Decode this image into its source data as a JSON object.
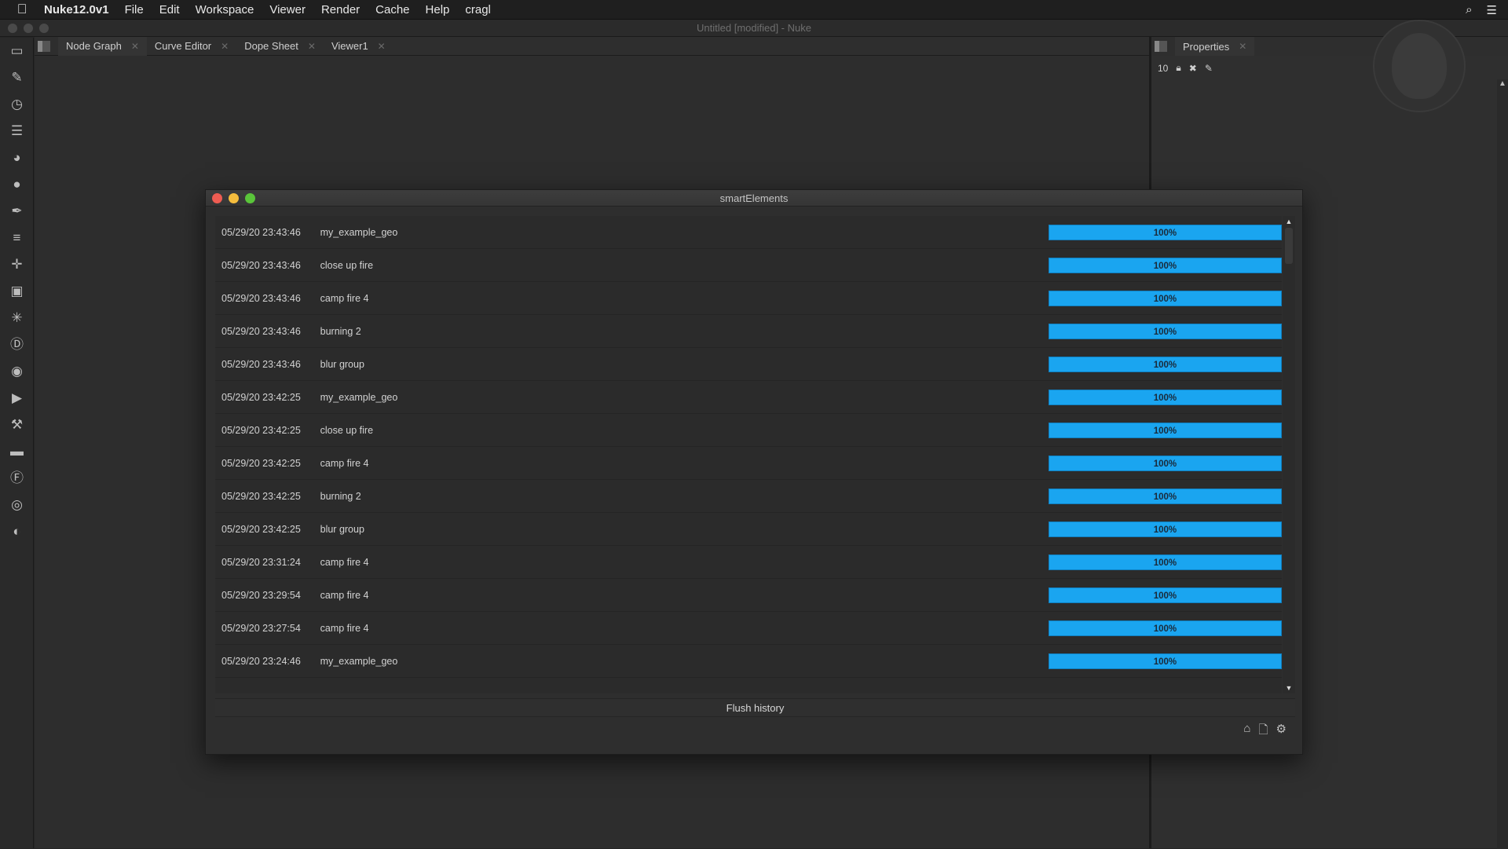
{
  "menubar": {
    "app_name": "Nuke12.0v1",
    "items": [
      "File",
      "Edit",
      "Workspace",
      "Viewer",
      "Render",
      "Cache",
      "Help",
      "cragl"
    ]
  },
  "window": {
    "title": "Untitled [modified] - Nuke"
  },
  "tabs": [
    {
      "label": "Node Graph"
    },
    {
      "label": "Curve Editor"
    },
    {
      "label": "Dope Sheet"
    },
    {
      "label": "Viewer1"
    }
  ],
  "properties": {
    "tab_label": "Properties",
    "max_panels": "10"
  },
  "dialog": {
    "title": "smartElements",
    "rows": [
      {
        "timestamp": "05/29/20 23:43:46",
        "name": "my_example_geo",
        "progress": "100%"
      },
      {
        "timestamp": "05/29/20 23:43:46",
        "name": "close up fire",
        "progress": "100%"
      },
      {
        "timestamp": "05/29/20 23:43:46",
        "name": "camp fire 4",
        "progress": "100%"
      },
      {
        "timestamp": "05/29/20 23:43:46",
        "name": "burning 2",
        "progress": "100%"
      },
      {
        "timestamp": "05/29/20 23:43:46",
        "name": "blur group",
        "progress": "100%"
      },
      {
        "timestamp": "05/29/20 23:42:25",
        "name": "my_example_geo",
        "progress": "100%"
      },
      {
        "timestamp": "05/29/20 23:42:25",
        "name": "close up fire",
        "progress": "100%"
      },
      {
        "timestamp": "05/29/20 23:42:25",
        "name": "camp fire 4",
        "progress": "100%"
      },
      {
        "timestamp": "05/29/20 23:42:25",
        "name": "burning 2",
        "progress": "100%"
      },
      {
        "timestamp": "05/29/20 23:42:25",
        "name": "blur group",
        "progress": "100%"
      },
      {
        "timestamp": "05/29/20 23:31:24",
        "name": "camp fire 4",
        "progress": "100%"
      },
      {
        "timestamp": "05/29/20 23:29:54",
        "name": "camp fire 4",
        "progress": "100%"
      },
      {
        "timestamp": "05/29/20 23:27:54",
        "name": "camp fire 4",
        "progress": "100%"
      },
      {
        "timestamp": "05/29/20 23:24:46",
        "name": "my_example_geo",
        "progress": "100%"
      }
    ],
    "flush_label": "Flush history"
  },
  "colors": {
    "progress": "#1aa5f0",
    "close": "#ee5c52",
    "minimize": "#f5bd3d",
    "maximize": "#5ac53a"
  },
  "icons": {
    "toolbar": [
      "image-icon",
      "draw-icon",
      "time-icon",
      "channel-icon",
      "color-icon",
      "filter-icon",
      "keyer-icon",
      "merge-icon",
      "transform-icon",
      "3d-icon",
      "particles-icon",
      "deep-icon",
      "views-icon",
      "metadata-icon",
      "toolsets-icon",
      "other-icon",
      "furnace-icon",
      "ocula-icon",
      "cara-vr-icon"
    ]
  }
}
